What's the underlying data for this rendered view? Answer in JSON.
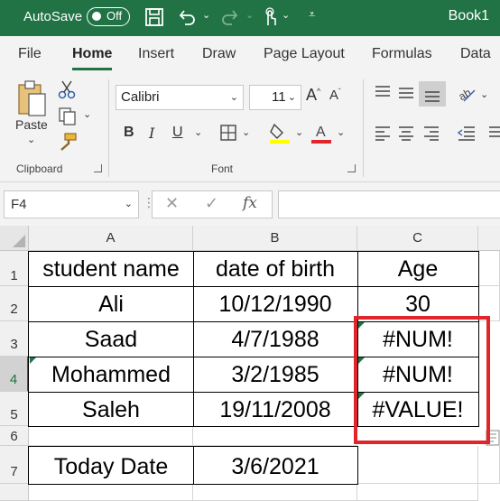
{
  "titlebar": {
    "autosave_label": "AutoSave",
    "autosave_state": "Off",
    "workbook_name": "Book1"
  },
  "ribbon_tabs": [
    "File",
    "Home",
    "Insert",
    "Draw",
    "Page Layout",
    "Formulas",
    "Data"
  ],
  "active_tab": "Home",
  "clipboard": {
    "paste_label": "Paste",
    "group_label": "Clipboard"
  },
  "font": {
    "name": "Calibri",
    "size": "11",
    "group_label": "Font",
    "bold": "B",
    "italic": "I",
    "underline": "U",
    "fill_color": "#ffff00",
    "font_color": "#e0262b"
  },
  "name_box": "F4",
  "formula_value": "",
  "columns": [
    "A",
    "B",
    "C"
  ],
  "rows": [
    {
      "num": "1",
      "a": "student name",
      "b": "date of birth",
      "c": "Age"
    },
    {
      "num": "2",
      "a": "Ali",
      "b": "10/12/1990",
      "c": "30"
    },
    {
      "num": "3",
      "a": "Saad",
      "b": "4/7/1988",
      "c": "#NUM!"
    },
    {
      "num": "4",
      "a": "Mohammed",
      "b": "3/2/1985",
      "c": "#NUM!"
    },
    {
      "num": "5",
      "a": "Saleh",
      "b": "19/11/2008",
      "c": "#VALUE!"
    },
    {
      "num": "6",
      "a": "",
      "b": "",
      "c": ""
    },
    {
      "num": "7",
      "a": "Today Date",
      "b": "3/6/2021",
      "c": ""
    }
  ],
  "colors": {
    "brand": "#217346",
    "highlight": "#e0262b"
  }
}
